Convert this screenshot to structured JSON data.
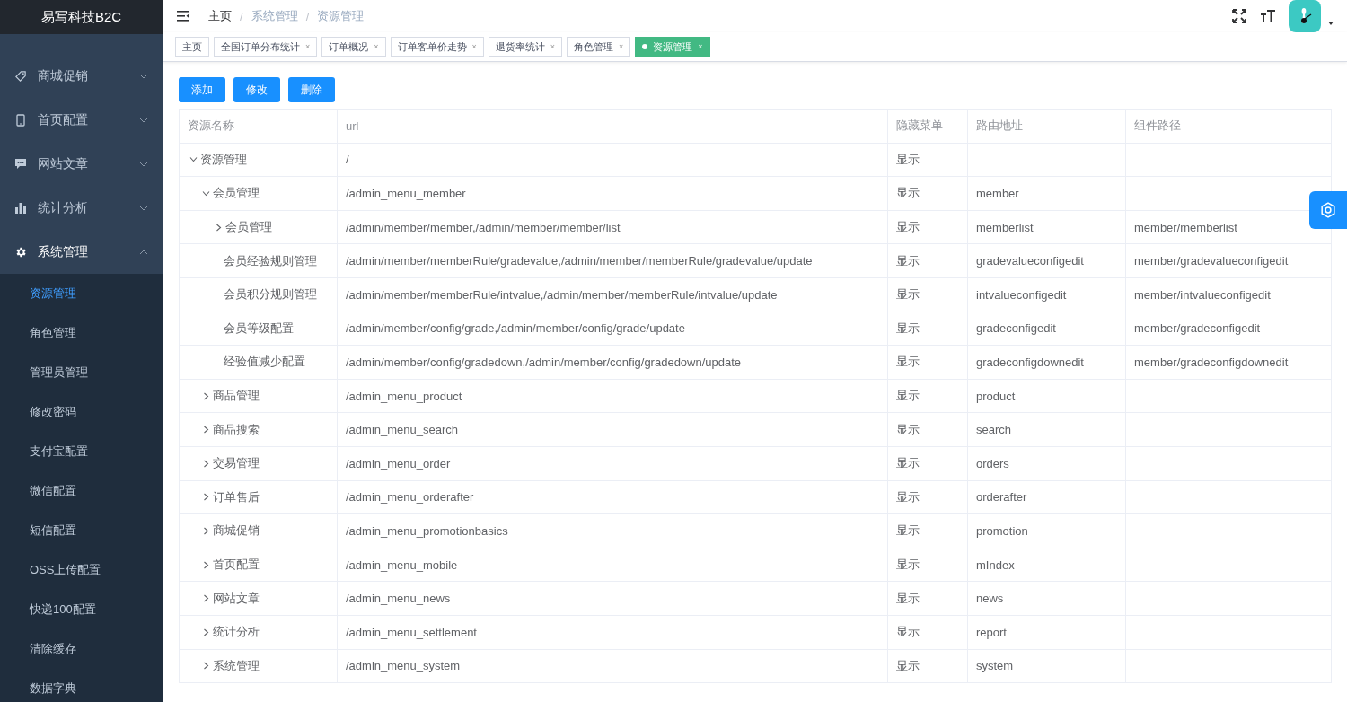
{
  "sidebar": {
    "logo": "易写科技B2C",
    "items": [
      {
        "label": "商城促销",
        "expanded": false
      },
      {
        "label": "首页配置",
        "expanded": false
      },
      {
        "label": "网站文章",
        "expanded": false
      },
      {
        "label": "统计分析",
        "expanded": false
      },
      {
        "label": "系统管理",
        "expanded": true,
        "children": [
          {
            "label": "资源管理",
            "selected": true
          },
          {
            "label": "角色管理",
            "selected": false
          },
          {
            "label": "管理员管理",
            "selected": false
          },
          {
            "label": "修改密码",
            "selected": false
          },
          {
            "label": "支付宝配置",
            "selected": false
          },
          {
            "label": "微信配置",
            "selected": false
          },
          {
            "label": "短信配置",
            "selected": false
          },
          {
            "label": "OSS上传配置",
            "selected": false
          },
          {
            "label": "快递100配置",
            "selected": false
          },
          {
            "label": "清除缓存",
            "selected": false
          },
          {
            "label": "数据字典",
            "selected": false
          }
        ]
      }
    ]
  },
  "breadcrumb": {
    "separator": "/",
    "items": [
      "主页",
      "系统管理",
      "资源管理"
    ]
  },
  "tags": [
    {
      "label": "主页",
      "selected": false
    },
    {
      "label": "全国订单分布统计",
      "selected": false,
      "close": "×"
    },
    {
      "label": "订单概况",
      "selected": false,
      "close": "×"
    },
    {
      "label": "订单客单价走势",
      "selected": false,
      "close": "×"
    },
    {
      "label": "退货率统计",
      "selected": false,
      "close": "×"
    },
    {
      "label": "角色管理",
      "selected": false,
      "close": "×"
    },
    {
      "label": "资源管理",
      "selected": true,
      "close": "×"
    }
  ],
  "buttons": [
    "添加",
    "修改",
    "删除"
  ],
  "table": {
    "columns": [
      "资源名称",
      "url",
      "隐藏菜单",
      "路由地址",
      "组件路径"
    ],
    "rows": [
      {
        "kind": "branch",
        "name": "资源管理",
        "url": "/",
        "hidden": "显示",
        "expanded": true,
        "children": [
          {
            "kind": "branch",
            "name": "会员管理",
            "url": "/admin_menu_member",
            "hidden": "显示",
            "route": "member",
            "expanded": true,
            "children": [
              {
                "kind": "branch",
                "name": "会员管理",
                "url": "/admin/member/member,/admin/member/member/list",
                "hidden": "显示",
                "route": "memberlist",
                "component": "member/memberlist",
                "expanded": false
              },
              {
                "kind": "leaf",
                "name": "会员经验规则管理",
                "url": "/admin/member/memberRule/gradevalue,/admin/member/memberRule/gradevalue/update",
                "hidden": "显示",
                "route": "gradevalueconfigedit",
                "component": "member/gradevalueconfigedit"
              },
              {
                "kind": "leaf",
                "name": "会员积分规则管理",
                "url": "/admin/member/memberRule/intvalue,/admin/member/memberRule/intvalue/update",
                "hidden": "显示",
                "route": "intvalueconfigedit",
                "component": "member/intvalueconfigedit"
              },
              {
                "kind": "leaf",
                "name": "会员等级配置",
                "url": "/admin/member/config/grade,/admin/member/config/grade/update",
                "hidden": "显示",
                "route": "gradeconfigedit",
                "component": "member/gradeconfigedit"
              },
              {
                "kind": "leaf",
                "name": "经验值减少配置",
                "url": "/admin/member/config/gradedown,/admin/member/config/gradedown/update",
                "hidden": "显示",
                "route": "gradeconfigdownedit",
                "component": "member/gradeconfigdownedit"
              }
            ]
          },
          {
            "kind": "branch",
            "name": "商品管理",
            "url": "/admin_menu_product",
            "hidden": "显示",
            "route": "product",
            "expanded": false
          },
          {
            "kind": "branch",
            "name": "商品搜索",
            "url": "/admin_menu_search",
            "hidden": "显示",
            "route": "search",
            "expanded": false
          },
          {
            "kind": "branch",
            "name": "交易管理",
            "url": "/admin_menu_order",
            "hidden": "显示",
            "route": "orders",
            "expanded": false
          },
          {
            "kind": "branch",
            "name": "订单售后",
            "url": "/admin_menu_orderafter",
            "hidden": "显示",
            "route": "orderafter",
            "expanded": false
          },
          {
            "kind": "branch",
            "name": "商城促销",
            "url": "/admin_menu_promotionbasics",
            "hidden": "显示",
            "route": "promotion",
            "expanded": false
          },
          {
            "kind": "branch",
            "name": "首页配置",
            "url": "/admin_menu_mobile",
            "hidden": "显示",
            "route": "mIndex",
            "expanded": false
          },
          {
            "kind": "branch",
            "name": "网站文章",
            "url": "/admin_menu_news",
            "hidden": "显示",
            "route": "news",
            "expanded": false
          },
          {
            "kind": "branch",
            "name": "统计分析",
            "url": "/admin_menu_settlement",
            "hidden": "显示",
            "route": "report",
            "expanded": false
          },
          {
            "kind": "branch",
            "name": "系统管理",
            "url": "/admin_menu_system",
            "hidden": "显示",
            "route": "system",
            "expanded": false
          }
        ]
      }
    ]
  }
}
